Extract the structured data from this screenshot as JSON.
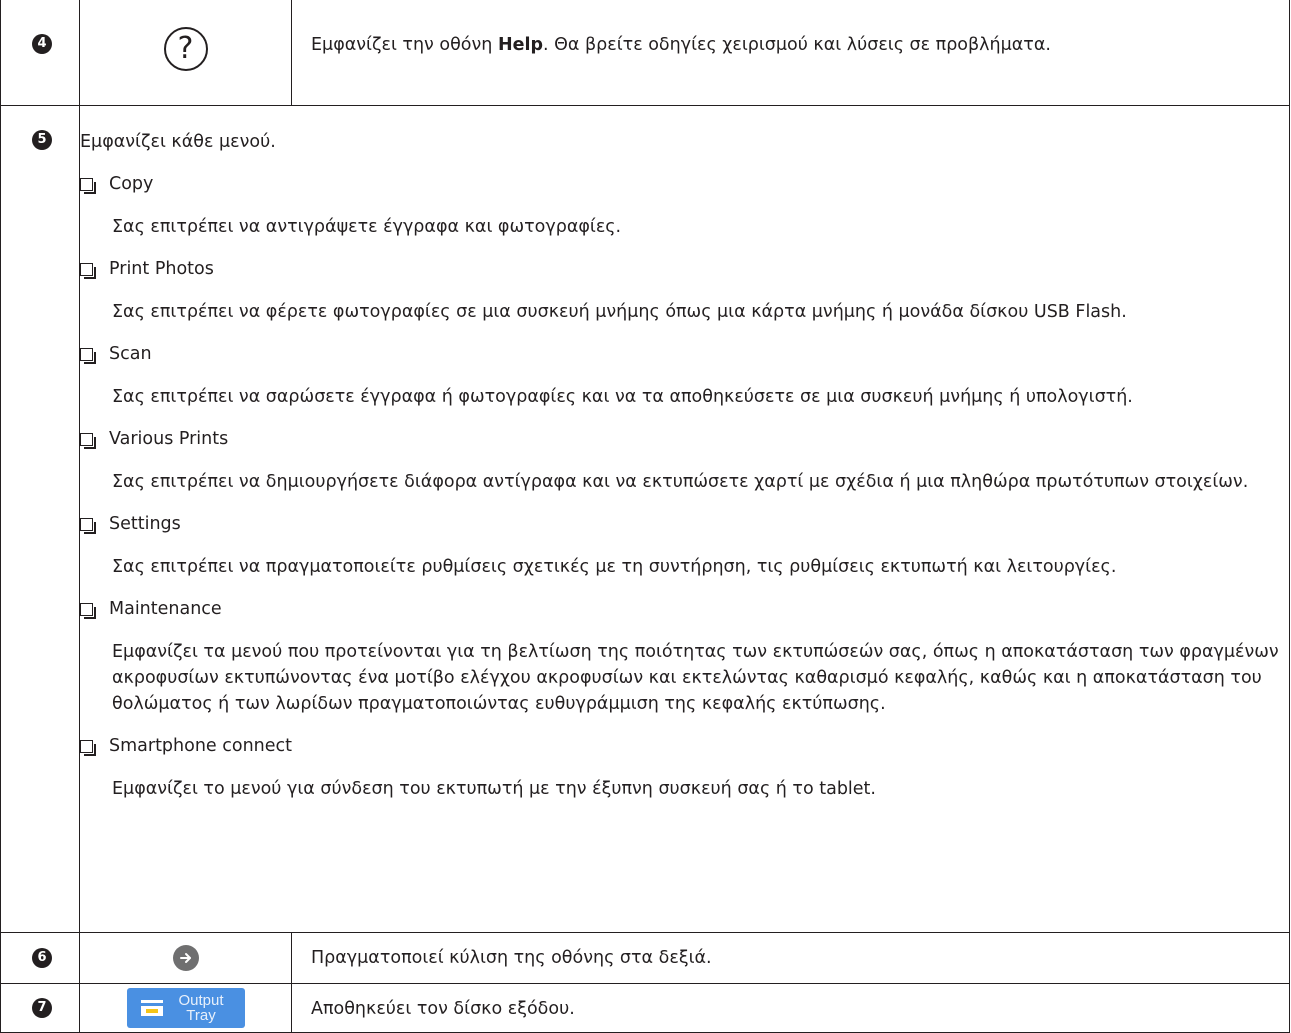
{
  "rows": [
    {
      "number": "4",
      "icon": "help-question-icon",
      "icon_glyph": "?",
      "description_bold": "Help",
      "description_pre": "Εμφανίζει την οθόνη ",
      "description_post": ". Θα βρείτε οδηγίες χειρισμού και λύσεις σε προβλήματα."
    },
    {
      "number": "5",
      "intro": "Εμφανίζει κάθε μενού.",
      "menu_items": [
        {
          "label": "Copy",
          "description": "Σας επιτρέπει να αντιγράψετε έγγραφα και φωτογραφίες."
        },
        {
          "label": "Print Photos",
          "description": "Σας επιτρέπει να φέρετε φωτογραφίες σε μια συσκευή μνήμης όπως μια κάρτα μνήμης ή μονάδα δίσκου USB Flash."
        },
        {
          "label": "Scan",
          "description": "Σας επιτρέπει να σαρώσετε έγγραφα ή φωτογραφίες και να τα αποθηκεύσετε σε μια συσκευή μνήμης ή υπολογιστή."
        },
        {
          "label": "Various Prints",
          "description": "Σας επιτρέπει να δημιουργήσετε διάφορα αντίγραφα και να εκτυπώσετε χαρτί με σχέδια ή μια πληθώρα πρωτότυπων στοιχείων."
        },
        {
          "label": "Settings",
          "description": "Σας επιτρέπει να πραγματοποιείτε ρυθμίσεις σχετικές με τη συντήρηση, τις ρυθμίσεις εκτυπωτή και λειτουργίες."
        },
        {
          "label": "Maintenance",
          "description": "Εμφανίζει τα μενού που προτείνονται για τη βελτίωση της ποιότητας των εκτυπώσεών σας, όπως η αποκατάσταση των φραγμένων ακροφυσίων εκτυπώνοντας ένα μοτίβο ελέγχου ακροφυσίων και εκτελώντας καθαρισμό κεφαλής, καθώς και η αποκατάσταση του θολώματος ή των λωρίδων πραγματοποιώντας ευθυγράμμιση της κεφαλής εκτύπωσης."
        },
        {
          "label": "Smartphone connect",
          "description": "Εμφανίζει το μενού για σύνδεση του εκτυπωτή με την έξυπνη συσκευή σας ή το tablet."
        }
      ]
    },
    {
      "number": "6",
      "icon": "scroll-right-arrow-icon",
      "description": "Πραγματοποιεί κύλιση της οθόνης στα δεξιά."
    },
    {
      "number": "7",
      "icon": "output-tray-icon",
      "button_line1": "Output",
      "button_line2": "Tray",
      "description": "Αποθηκεύει τον δίσκο εξόδου."
    }
  ],
  "colors": {
    "text": "#231f20",
    "arrow_circle": "#6f6f70",
    "output_button": "#4a90e2"
  }
}
